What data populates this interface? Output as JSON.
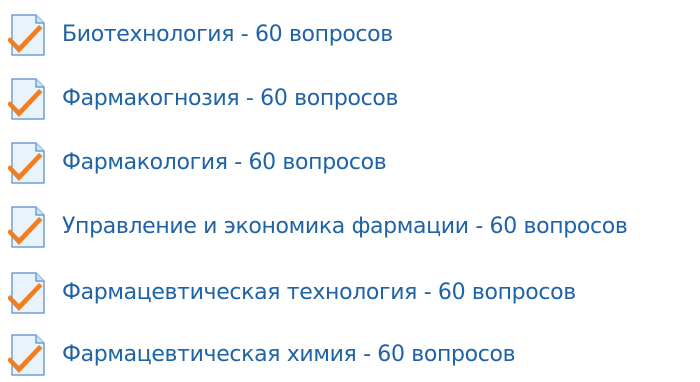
{
  "quiz_list": {
    "icon": "quiz-checklist-icon",
    "colors": {
      "link": "#1f63a7",
      "icon_paper": "#eaf2fb",
      "icon_paper_border": "#6f9ed4",
      "icon_check": "#f07f22"
    },
    "items": [
      {
        "label": "Биотехнология - 60 вопросов"
      },
      {
        "label": "Фармакогнозия - 60 вопросов"
      },
      {
        "label": "Фармакология - 60 вопросов"
      },
      {
        "label": "Управление и экономика фармации - 60 вопросов"
      },
      {
        "label": "Фармацевтическая технология - 60 вопросов"
      },
      {
        "label": "Фармацевтическая химия - 60 вопросов"
      }
    ]
  }
}
